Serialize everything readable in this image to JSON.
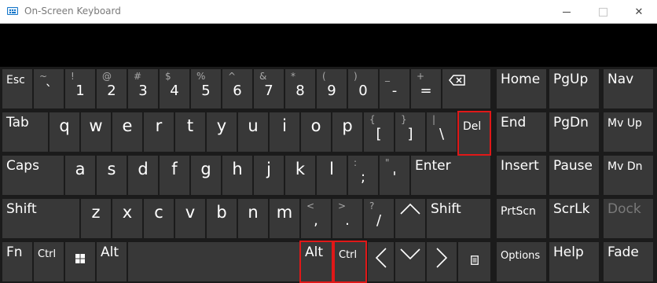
{
  "window": {
    "title": "On-Screen Keyboard",
    "minimize": "–",
    "close": "✕"
  },
  "keys": {
    "esc": "Esc",
    "tilde_top": "~",
    "tilde_bot": "`",
    "n1_top": "!",
    "n1_bot": "1",
    "n2_top": "@",
    "n2_bot": "2",
    "n3_top": "#",
    "n3_bot": "3",
    "n4_top": "$",
    "n4_bot": "4",
    "n5_top": "%",
    "n5_bot": "5",
    "n6_top": "^",
    "n6_bot": "6",
    "n7_top": "&",
    "n7_bot": "7",
    "n8_top": "*",
    "n8_bot": "8",
    "n9_top": "(",
    "n9_bot": "9",
    "n0_top": ")",
    "n0_bot": "0",
    "minus_top": "_",
    "minus_bot": "-",
    "equals_top": "+",
    "equals_bot": "=",
    "home": "Home",
    "pgup": "PgUp",
    "nav": "Nav",
    "tab": "Tab",
    "q": "q",
    "w": "w",
    "e": "e",
    "r": "r",
    "t": "t",
    "y": "y",
    "u": "u",
    "i": "i",
    "o": "o",
    "p": "p",
    "lbracket_top": "{",
    "lbracket_bot": "[",
    "rbracket_top": "}",
    "rbracket_bot": "]",
    "pipe_top": "|",
    "pipe_bot": "\\",
    "del": "Del",
    "end": "End",
    "pgdn": "PgDn",
    "mvup": "Mv Up",
    "caps": "Caps",
    "a": "a",
    "s": "s",
    "d": "d",
    "f": "f",
    "g": "g",
    "h": "h",
    "j": "j",
    "k": "k",
    "l": "l",
    "semicolon_top": ":",
    "semicolon_bot": ";",
    "quote_top": "\"",
    "quote_bot": "'",
    "enter": "Enter",
    "insert": "Insert",
    "pause": "Pause",
    "mvdn": "Mv Dn",
    "shift_left": "Shift",
    "z": "z",
    "x": "x",
    "c": "c",
    "v": "v",
    "b": "b",
    "n": "n",
    "m": "m",
    "comma_top": "<",
    "comma_bot": ",",
    "period_top": ">",
    "period_bot": ".",
    "slash_top": "?",
    "slash_bot": "/",
    "shift_right": "Shift",
    "prtscn": "PrtScn",
    "scrlk": "ScrLk",
    "dock": "Dock",
    "fn": "Fn",
    "ctrl_left": "Ctrl",
    "alt_left": "Alt",
    "alt_right": "Alt",
    "ctrl_right": "Ctrl",
    "options": "Options",
    "help": "Help",
    "fade": "Fade"
  },
  "icons": {
    "backspace": "backspace-icon",
    "windows": "windows-logo-icon",
    "up": "arrow-up-icon",
    "down": "arrow-down-icon",
    "left": "arrow-left-icon",
    "right": "arrow-right-icon",
    "menu": "context-menu-icon"
  },
  "colors": {
    "key": "#383838",
    "background": "#1b1b1b",
    "highlight": "#e01818"
  }
}
